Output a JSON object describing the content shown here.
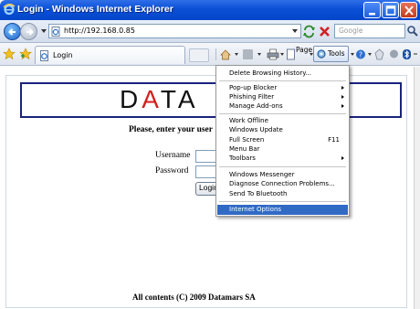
{
  "window": {
    "title": "Login - Windows Internet Explorer"
  },
  "address": {
    "url": "http://192.168.0.85",
    "search_placeholder": "Google"
  },
  "tab": {
    "label": "Login"
  },
  "commands": {
    "page_label": "Page",
    "tools_label": "Tools"
  },
  "page": {
    "logo": {
      "prefix": "D",
      "a1": "A",
      "t": "T",
      "a2": "A"
    },
    "prompt": "Please, enter your user",
    "username_label": "Username",
    "password_label": "Password",
    "login_button": "Login",
    "footer": "All contents (C) 2009 Datamars SA"
  },
  "tools_menu": {
    "items": [
      {
        "label": "Delete Browsing History..."
      },
      {
        "label": "Pop-up Blocker",
        "submenu": true
      },
      {
        "label": "Phishing Filter",
        "submenu": true
      },
      {
        "label": "Manage Add-ons",
        "submenu": true
      },
      {
        "label": "Work Offline"
      },
      {
        "label": "Windows Update"
      },
      {
        "label": "Full Screen",
        "shortcut": "F11"
      },
      {
        "label": "Menu Bar"
      },
      {
        "label": "Toolbars",
        "submenu": true
      },
      {
        "label": "Windows Messenger"
      },
      {
        "label": "Diagnose Connection Problems..."
      },
      {
        "label": "Send To Bluetooth"
      },
      {
        "label": "Internet Options",
        "highlighted": true
      }
    ]
  },
  "colors": {
    "titlebar": "#0a4fd6",
    "highlight": "#316ac5",
    "logo_red": "#d21f1f",
    "logo_border": "#1a237e"
  }
}
